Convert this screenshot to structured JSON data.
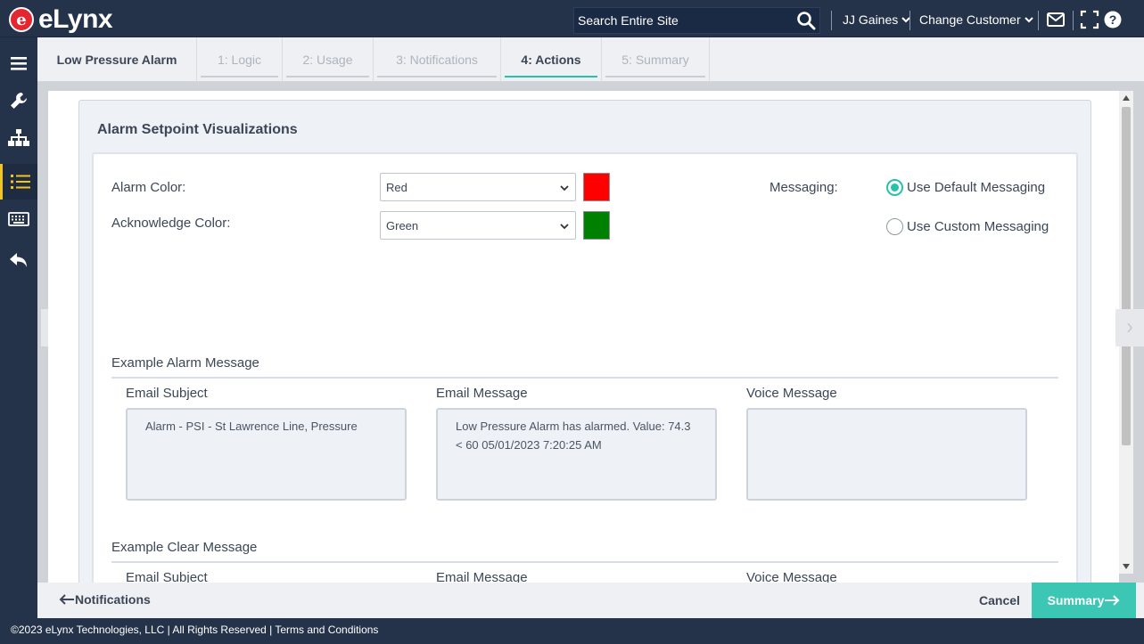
{
  "header": {
    "logo_letter": "e",
    "logo_text": "eLynx",
    "search_placeholder": "Search Entire Site",
    "user_name": "JJ Gaines",
    "change_customer": "Change Customer",
    "icons": [
      "search-icon",
      "envelope-icon",
      "fullscreen-icon",
      "help-icon"
    ]
  },
  "sidebar": {
    "items": [
      {
        "icon": "hamburger-icon"
      },
      {
        "icon": "wrench-icon"
      },
      {
        "icon": "hierarchy-icon"
      },
      {
        "icon": "list-icon",
        "active": true
      },
      {
        "icon": "keyboard-icon"
      },
      {
        "icon": "reply-icon"
      }
    ]
  },
  "tabs": {
    "title": "Low Pressure Alarm",
    "items": [
      "1: Logic",
      "2: Usage",
      "3: Notifications",
      "4: Actions",
      "5: Summary"
    ],
    "active": "4: Actions"
  },
  "panel": {
    "title": "Alarm Setpoint Visualizations",
    "alarm_color_label": "Alarm Color:",
    "alarm_color_value": "Red",
    "alarm_swatch": "#ff0000",
    "ack_color_label": "Acknowledge Color:",
    "ack_color_value": "Green",
    "ack_swatch": "#008000",
    "messaging_label": "Messaging:",
    "messaging_options": [
      "Use Default Messaging",
      "Use Custom Messaging"
    ],
    "messaging_selected": "Use Default Messaging"
  },
  "alarm_example": {
    "heading": "Example Alarm Message",
    "email_subject_label": "Email Subject",
    "email_subject": "Alarm - PSI - St Lawrence Line, Pressure",
    "email_message_label": "Email Message",
    "email_message": "Low Pressure Alarm has alarmed. Value: 74.3 < 60 05/01/2023 7:20:25 AM",
    "voice_message_label": "Voice Message",
    "voice_message": ""
  },
  "clear_example": {
    "heading": "Example Clear Message",
    "email_subject_label": "Email Subject",
    "email_message_label": "Email Message",
    "voice_message_label": "Voice Message"
  },
  "footer": {
    "back_label": "Notifications",
    "cancel_label": "Cancel",
    "next_label": "Summary",
    "copyright": "©2023 eLynx Technologies, LLC | All Rights Reserved | Terms and Conditions"
  },
  "colors": {
    "accent": "#28c2aa",
    "nav_bg": "#25334a",
    "next_button": "#3cc7b4"
  }
}
